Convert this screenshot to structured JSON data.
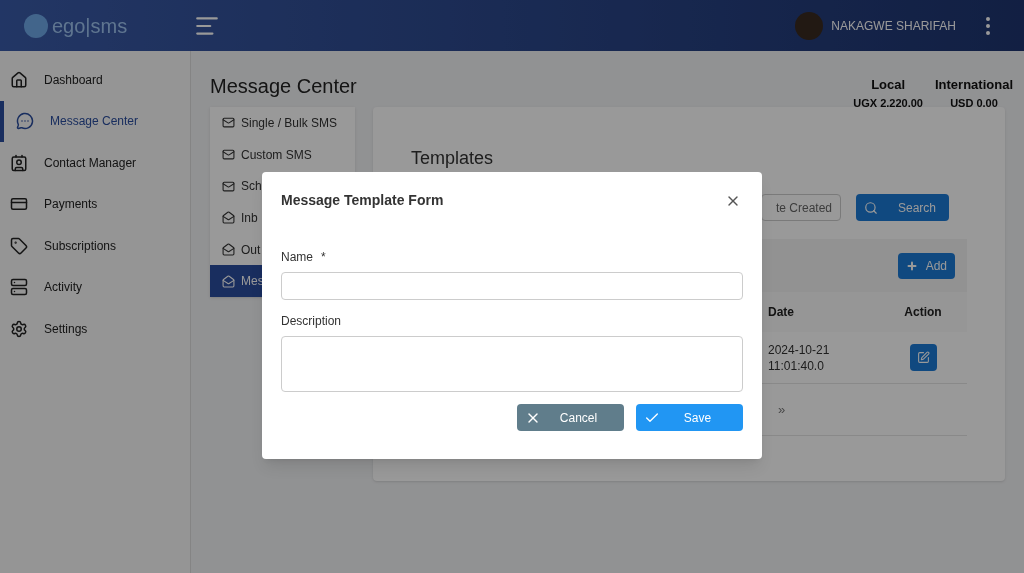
{
  "header": {
    "logo": "ego|sms",
    "user": "NAKAGWE SHARIFAH"
  },
  "sidebar": {
    "items": [
      {
        "label": "Dashboard",
        "selected": false
      },
      {
        "label": "Message Center",
        "selected": true
      },
      {
        "label": "Contact Manager",
        "selected": false
      },
      {
        "label": "Payments",
        "selected": false
      },
      {
        "label": "Subscriptions",
        "selected": false
      },
      {
        "label": "Activity",
        "selected": false
      },
      {
        "label": "Settings",
        "selected": false
      }
    ]
  },
  "page": {
    "title": "Message Center",
    "balances": [
      {
        "label": "Local",
        "value": "UGX 2,220.00"
      },
      {
        "label": "International",
        "value": "USD 0.00"
      }
    ]
  },
  "submenu": {
    "items": [
      {
        "label": "Single / Bulk SMS",
        "kind": "mail",
        "selected": false
      },
      {
        "label": "Custom SMS",
        "kind": "mail",
        "selected": false
      },
      {
        "label": "Sch",
        "kind": "mail",
        "selected": false
      },
      {
        "label": "Inb",
        "kind": "inbox",
        "selected": false
      },
      {
        "label": "Out",
        "kind": "inbox",
        "selected": false
      },
      {
        "label": "Mes",
        "kind": "inbox",
        "selected": true
      }
    ]
  },
  "templates": {
    "title": "Templates",
    "search_field": {
      "placeholder": "te Created"
    },
    "search_button": "Search",
    "add_button": "Add",
    "table": {
      "columns": [
        "Date",
        "Action"
      ],
      "rows": [
        {
          "date": "2024-10-21 11:01:40.0"
        }
      ]
    },
    "pagination": "»"
  },
  "modal": {
    "title": "Message Template Form",
    "required_marker": "*",
    "fields": [
      {
        "label": "Name",
        "required": true,
        "kind": "input"
      },
      {
        "label": "Description",
        "required": false,
        "kind": "textarea"
      }
    ],
    "buttons": [
      {
        "label": "Cancel",
        "kind": "cancel"
      },
      {
        "label": "Save",
        "kind": "save"
      }
    ]
  }
}
